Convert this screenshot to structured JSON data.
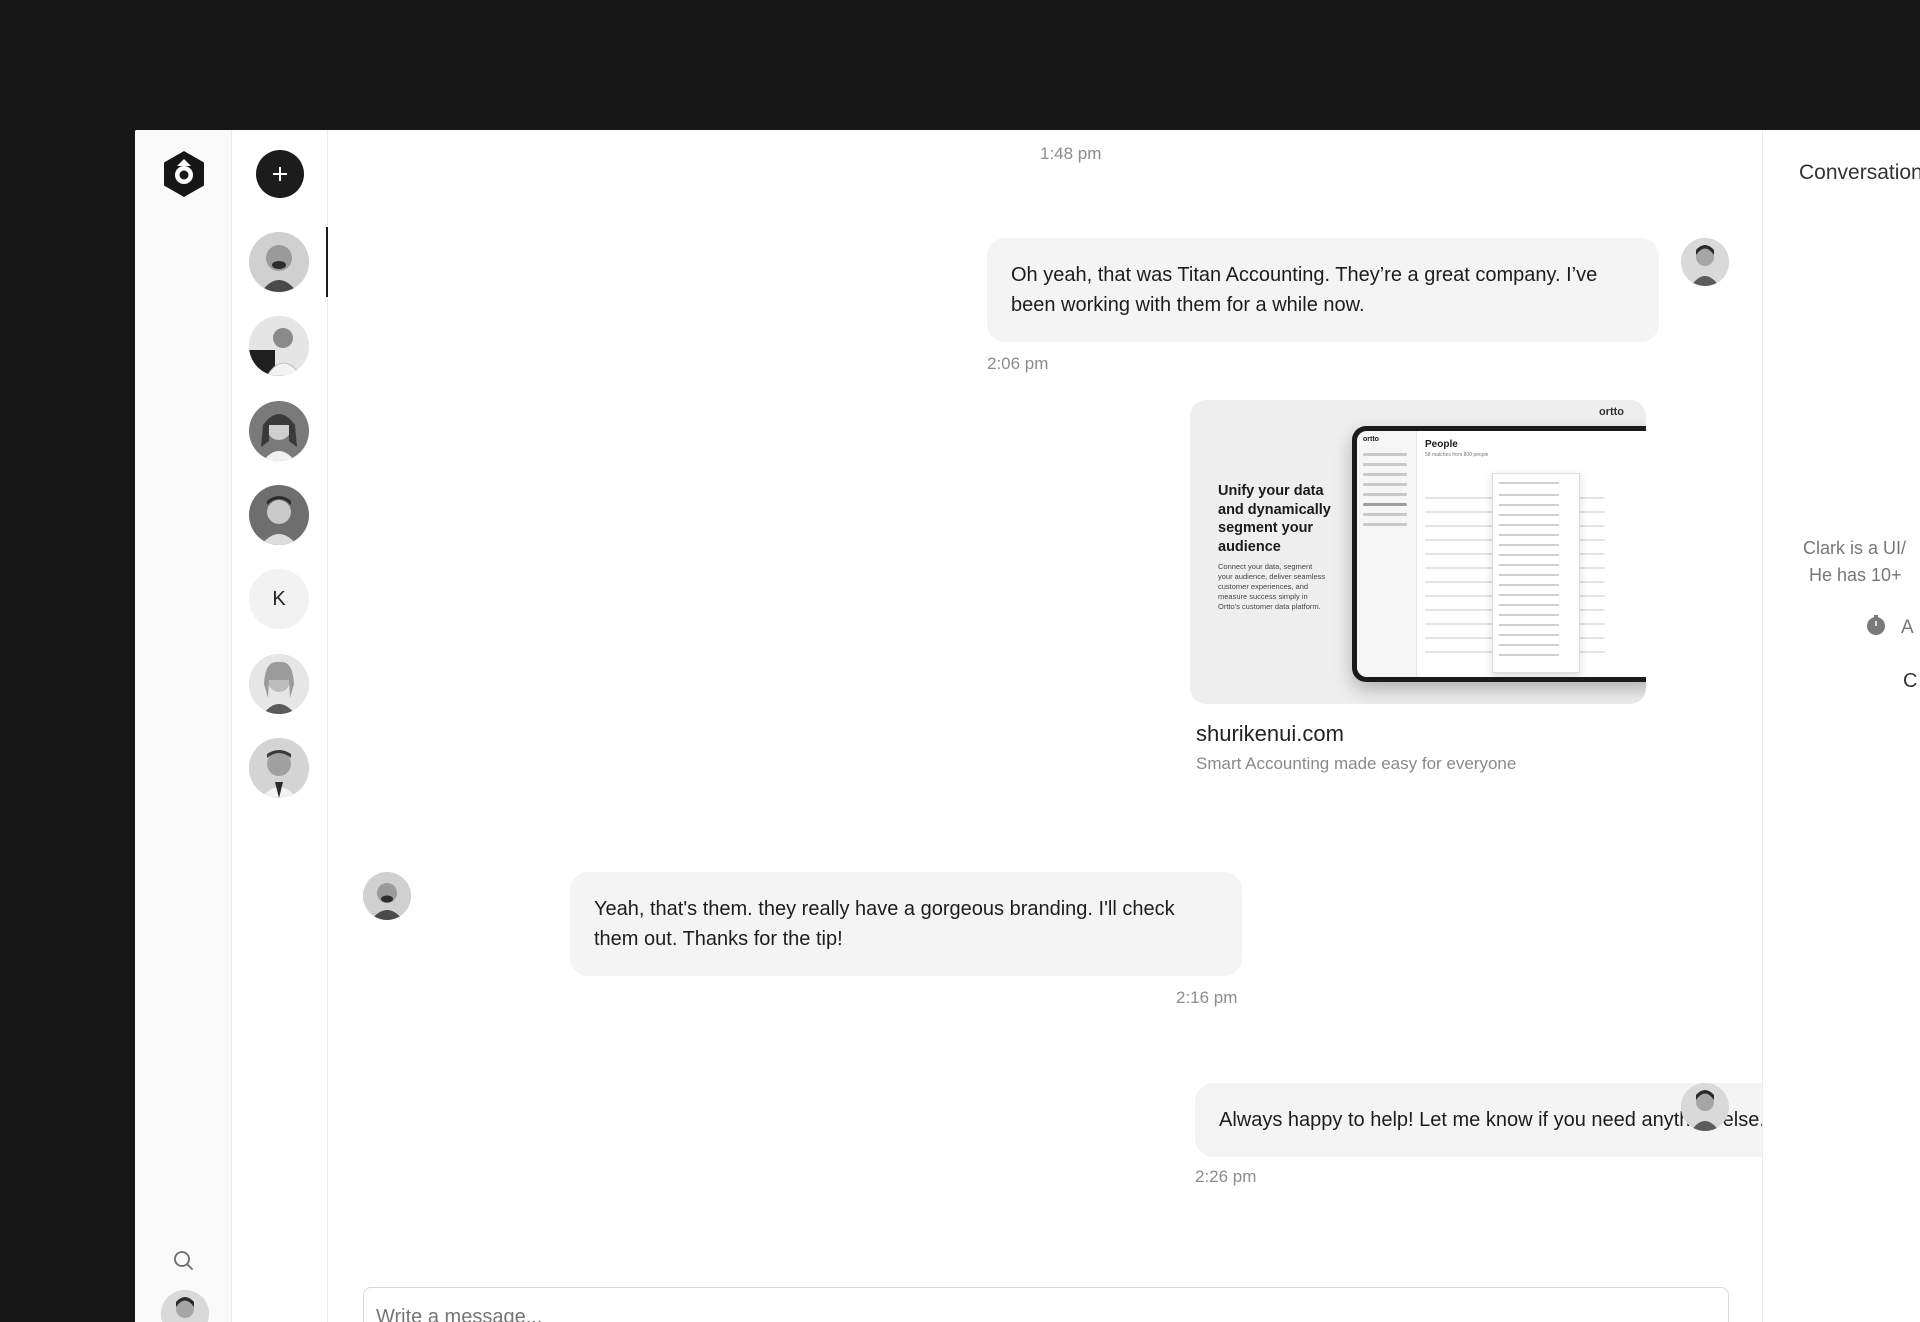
{
  "app": {
    "rail": {
      "logo_icon": "hexagon-logo-icon",
      "search_icon": "search-icon",
      "settings_icon": "gear-icon"
    },
    "contacts": {
      "new_button_icon": "plus-icon",
      "letter_contact": "K"
    }
  },
  "conversation": {
    "top_time": "1:48 pm",
    "messages": [
      {
        "text": "Oh yeah, that was Titan Accounting. They’re a great company. I’ve been working with them for a while now.",
        "time": "2:06 pm"
      },
      {
        "text": "Yeah, that's them. they really have a gorgeous branding. I'll check them out. Thanks for the tip!",
        "time": "2:16 pm"
      },
      {
        "text": "Always happy to help! Let me know if you need anything else.",
        "time": "2:26 pm"
      }
    ],
    "link_preview": {
      "headline": "Unify your data and dynamically segment your audience",
      "body": "Connect your data, segment your audience, deliver seamless customer experiences, and measure success simply in Ortto's customer data platform.",
      "brand": "ortto",
      "screen_logo": "ortto",
      "screen_title": "People",
      "screen_subtitle": "58 matches from 800 people",
      "site": "shurikenui.com",
      "description": "Smart Accounting made easy for everyone"
    },
    "composer_placeholder": "Write a message..."
  },
  "details": {
    "title": "Conversation",
    "bio_line1": "Clark is a UI/",
    "bio_line2": "He has 10+",
    "stat_icon": "timer-icon",
    "stat_text": "A",
    "extra_text": "C"
  }
}
